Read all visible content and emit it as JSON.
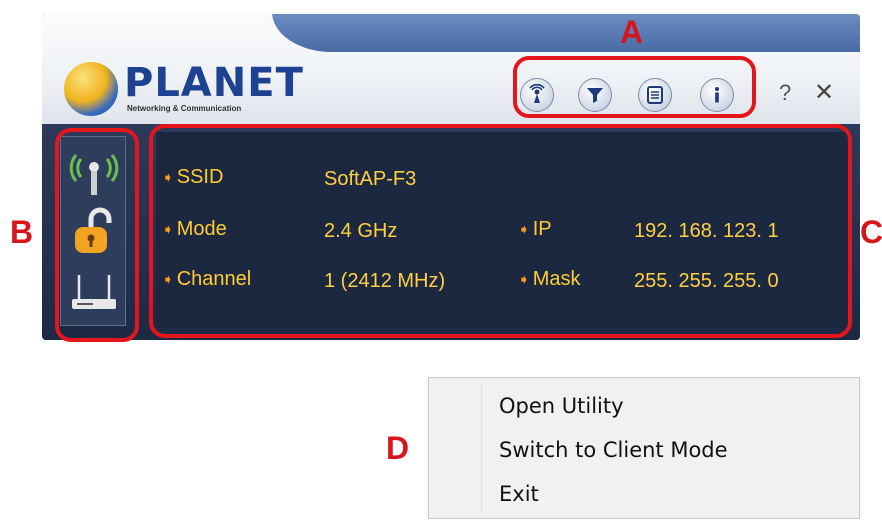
{
  "window": {
    "logo": {
      "name": "PLANET",
      "tagline": "Networking & Communication"
    },
    "toolbar": {
      "buttons": [
        {
          "icon": "access-point-icon"
        },
        {
          "icon": "filter-icon"
        },
        {
          "icon": "list-icon"
        },
        {
          "icon": "info-icon"
        }
      ],
      "help_label": "?",
      "close_label": "✕"
    },
    "info": {
      "ssid_label": "SSID",
      "ssid_value": "SoftAP-F3",
      "mode_label": "Mode",
      "mode_value": "2.4 GHz",
      "channel_label": "Channel",
      "channel_value": "1 (2412 MHz)",
      "ip_label": "IP",
      "ip_value": "192. 168. 123. 1",
      "mask_label": "Mask",
      "mask_value": "255. 255. 255. 0"
    }
  },
  "annotations": {
    "a": "A",
    "b": "B",
    "c": "C",
    "d": "D"
  },
  "context_menu": {
    "items": [
      "Open Utility",
      "Switch to Client Mode",
      "Exit"
    ]
  },
  "colors": {
    "annotation": "#e4161b",
    "info_text": "#ffd040",
    "panel_bg": "#1c2740",
    "brand_blue": "#1e4292"
  }
}
